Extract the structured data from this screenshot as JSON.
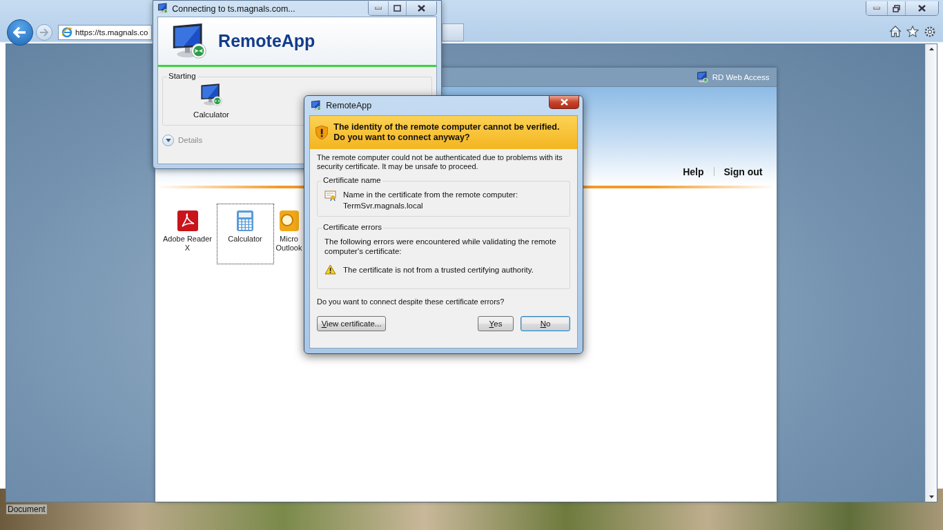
{
  "browser": {
    "address": "https://ts.magnals.co",
    "status_bar": "Document"
  },
  "web_page": {
    "header_title": "RD Web Access",
    "nav": [
      "Help",
      "Sign out"
    ],
    "apps": [
      {
        "label": "Adobe Reader X",
        "kind": "pdf",
        "selected": false
      },
      {
        "label": "Calculator",
        "kind": "calculator",
        "selected": true
      },
      {
        "label": "Micro Outlook",
        "kind": "mail",
        "selected": false
      }
    ]
  },
  "connecting_window": {
    "title": "Connecting to ts.magnals.com...",
    "heading": "RemoteApp",
    "group_label": "Starting",
    "program": "Calculator",
    "details": "Details"
  },
  "dialog": {
    "title": "RemoteApp",
    "warning": "The identity of the remote computer cannot be verified. Do you want to connect anyway?",
    "message": "The remote computer could not be authenticated due to problems with its security certificate. It may be unsafe to proceed.",
    "certificate_name": {
      "label": "Certificate name",
      "line_1": "Name in the certificate from the remote computer:",
      "line_2": "TermSvr.magnals.local"
    },
    "certificate_errors": {
      "label": "Certificate errors",
      "intro": "The following errors were encountered while validating the remote computer's certificate:",
      "errors": [
        "The certificate is not from a trusted certifying authority."
      ]
    },
    "question": "Do you want to connect despite these certificate errors?",
    "buttons": [
      {
        "label": "View certificate...",
        "default": false
      },
      {
        "label": "Yes",
        "default": false
      },
      {
        "label": "No",
        "default": true
      }
    ]
  }
}
